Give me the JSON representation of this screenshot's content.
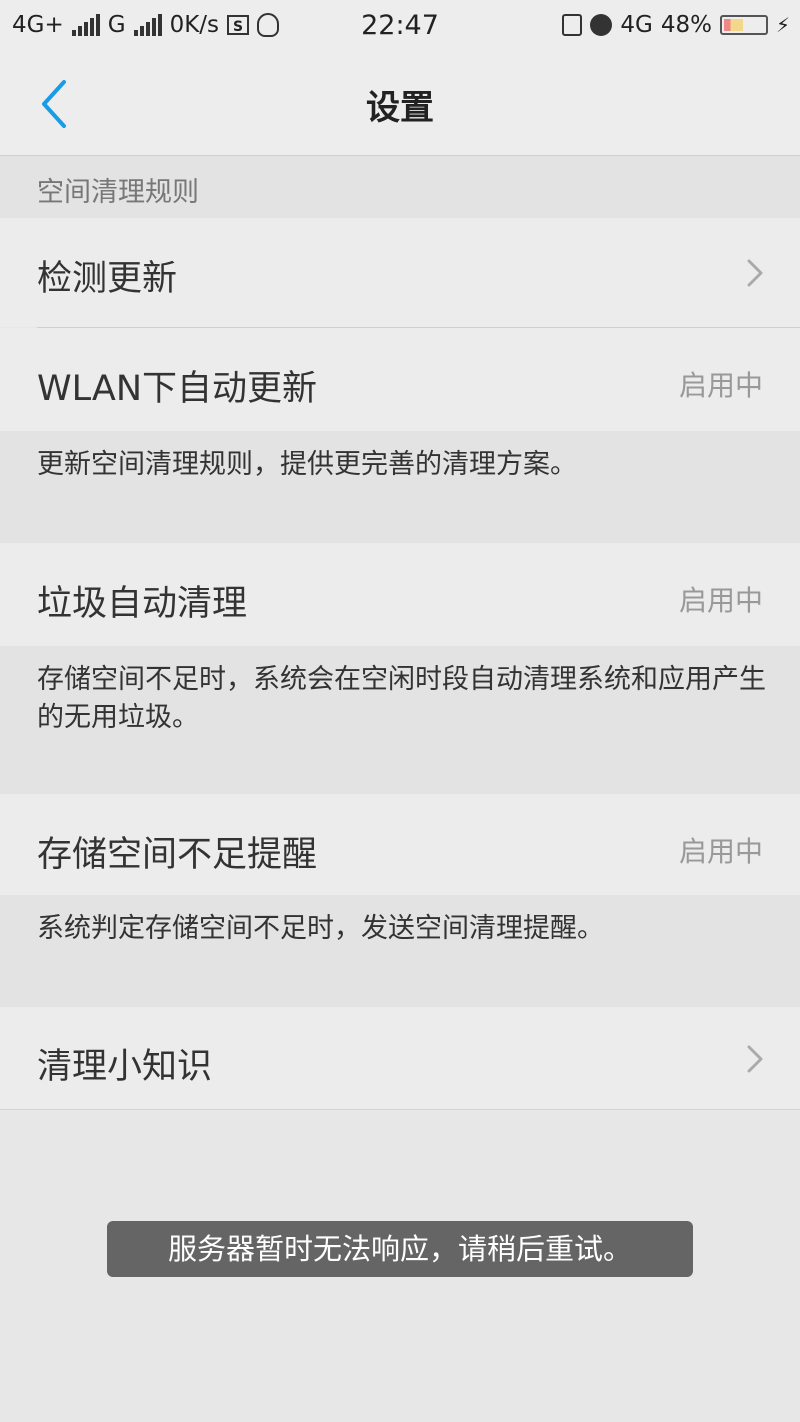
{
  "status_bar": {
    "network1": "4G+",
    "network2": "G",
    "speed": "0K/s",
    "sq_icon_text": "S",
    "time": "22:47",
    "network3": "4G",
    "battery_pct": "48%",
    "battery_level": 0.48,
    "icons": [
      "signal-icon",
      "signal-icon",
      "screenshot-icon",
      "qq-icon",
      "vibrate-icon",
      "alarm-icon",
      "battery-icon",
      "charging-icon"
    ]
  },
  "header": {
    "title": "设置",
    "back_icon": "chevron-left-icon"
  },
  "section": {
    "title": "空间清理规则"
  },
  "items": [
    {
      "label": "检测更新",
      "icon": "chevron-right-icon"
    },
    {
      "label": "WLAN下自动更新",
      "status": "启用中",
      "description": "更新空间清理规则，提供更完善的清理方案。"
    },
    {
      "label": "垃圾自动清理",
      "status": "启用中",
      "description": "存储空间不足时，系统会在空闲时段自动清理系统和应用产生的无用垃圾。"
    },
    {
      "label": "存储空间不足提醒",
      "status": "启用中",
      "description": "系统判定存储空间不足时，发送空间清理提醒。"
    },
    {
      "label": "清理小知识",
      "icon": "chevron-right-icon"
    }
  ],
  "toast": {
    "message": "服务器暂时无法响应，请稍后重试。"
  },
  "colors": {
    "accent": "#1a9be8",
    "background": "#e7e7e7",
    "row_background": "#ececec",
    "status_text": "#999999"
  }
}
